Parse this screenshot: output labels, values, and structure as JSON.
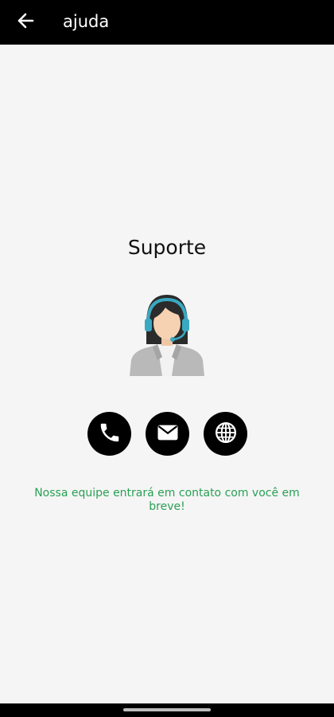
{
  "header": {
    "title": "ajuda",
    "back_icon": "arrow-left-icon"
  },
  "main": {
    "title": "Suporte",
    "illustration": "support-agent-headset",
    "actions": [
      {
        "icon": "phone-icon"
      },
      {
        "icon": "envelope-icon"
      },
      {
        "icon": "globe-icon"
      }
    ],
    "message": "Nossa equipe entrará em contato com você em breve!"
  },
  "colors": {
    "app_bar": "#000000",
    "background": "#f5f5f5",
    "message_text": "#2aa055",
    "headset": "#3aa8c1"
  }
}
